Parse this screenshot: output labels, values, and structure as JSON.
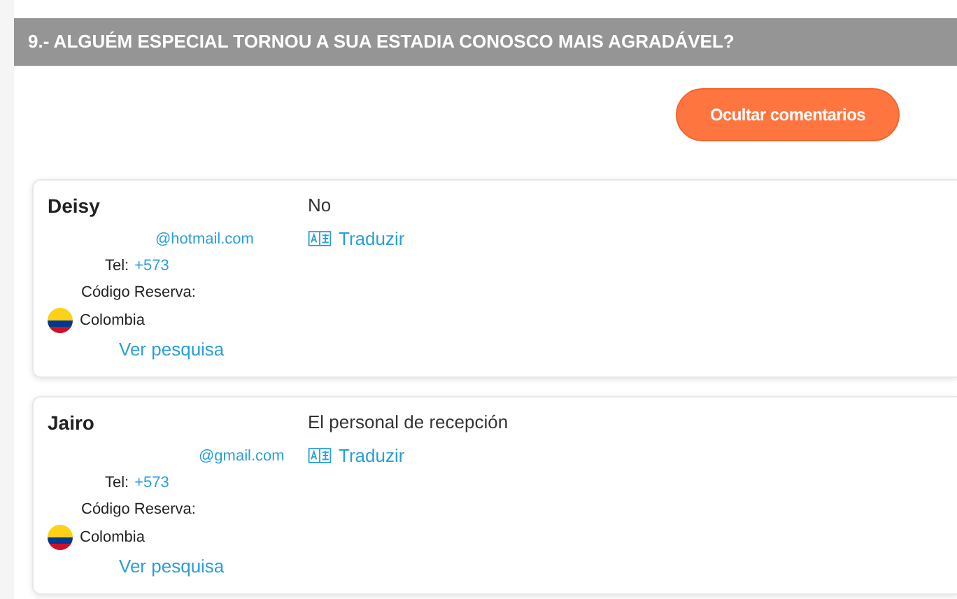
{
  "question": {
    "title": "9.- ALGUÉM ESPECIAL TORNOU A SUA ESTADIA CONOSCO MAIS AGRADÁVEL?"
  },
  "toggle_button": {
    "label": "Ocultar comentarios"
  },
  "comments": [
    {
      "name": "Deisy",
      "email": "@hotmail.com",
      "tel_label": "Tel:",
      "tel": "+573",
      "code_label": "Código Reserva:",
      "country": "Colombia",
      "survey_link": "Ver pesquisa",
      "answer": "No",
      "translate": "Traduzir"
    },
    {
      "name": "Jairo",
      "email": "@gmail.com",
      "tel_label": "Tel:",
      "tel": "+573",
      "code_label": "Código Reserva:",
      "country": "Colombia",
      "survey_link": "Ver pesquisa",
      "answer": "El personal de recepción",
      "translate": "Traduzir"
    }
  ]
}
